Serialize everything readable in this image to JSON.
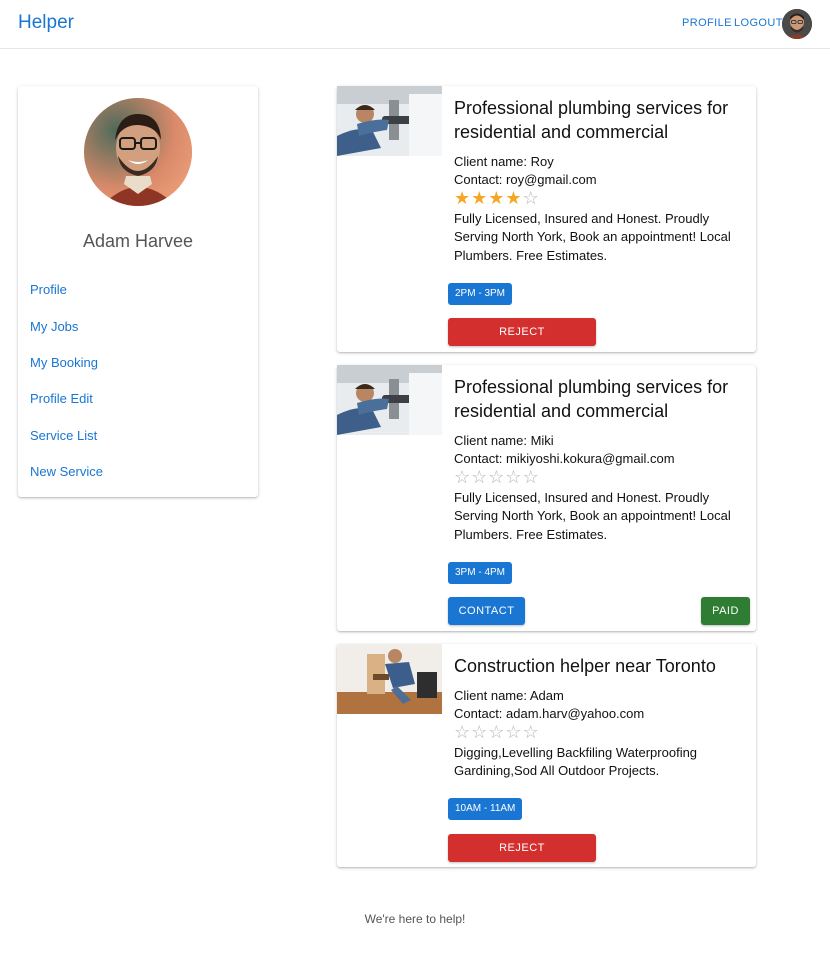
{
  "header": {
    "brand": "Helper",
    "nav": {
      "profile": "PROFILE",
      "logout": "LOGOUT"
    },
    "avatar_icon": "user-avatar"
  },
  "sidebar": {
    "name": "Adam Harvee",
    "links": [
      "Profile",
      "My Jobs",
      "My Booking",
      "Profile Edit",
      "Service List",
      "New Service"
    ]
  },
  "jobs": [
    {
      "title": "Professional plumbing services for residential and commercial",
      "client": "Client name: Roy",
      "contact": "Contact: roy@gmail.com",
      "rating": 4,
      "rating_max": 5,
      "description": "Fully Licensed, Insured and Honest. Proudly Serving North York, Book an appointment! Local Plumbers. Free Estimates.",
      "time": "2PM - 3PM",
      "actions": [
        "REJECT"
      ]
    },
    {
      "title": "Professional plumbing services for residential and commercial",
      "client": "Client name: Miki",
      "contact": "Contact: mikiyoshi.kokura@gmail.com",
      "rating": 0,
      "rating_max": 5,
      "description": "Fully Licensed, Insured and Honest. Proudly Serving North York, Book an appointment! Local Plumbers. Free Estimates.",
      "time": "3PM - 4PM",
      "actions": [
        "CONTACT",
        "PAID"
      ]
    },
    {
      "title": "Construction helper near Toronto",
      "client": "Client name: Adam",
      "contact": "Contact: adam.harv@yahoo.com",
      "rating": 0,
      "rating_max": 5,
      "description": "Digging,Levelling Backfiling Waterproofing Gardining,Sod All Outdoor Projects.",
      "time": "10AM - 11AM",
      "actions": [
        "REJECT"
      ]
    }
  ],
  "footer": "We're here to help!",
  "colors": {
    "primary": "#1976d2",
    "reject": "#d32f2f",
    "paid": "#2e7d32",
    "star": "#f5a623"
  }
}
